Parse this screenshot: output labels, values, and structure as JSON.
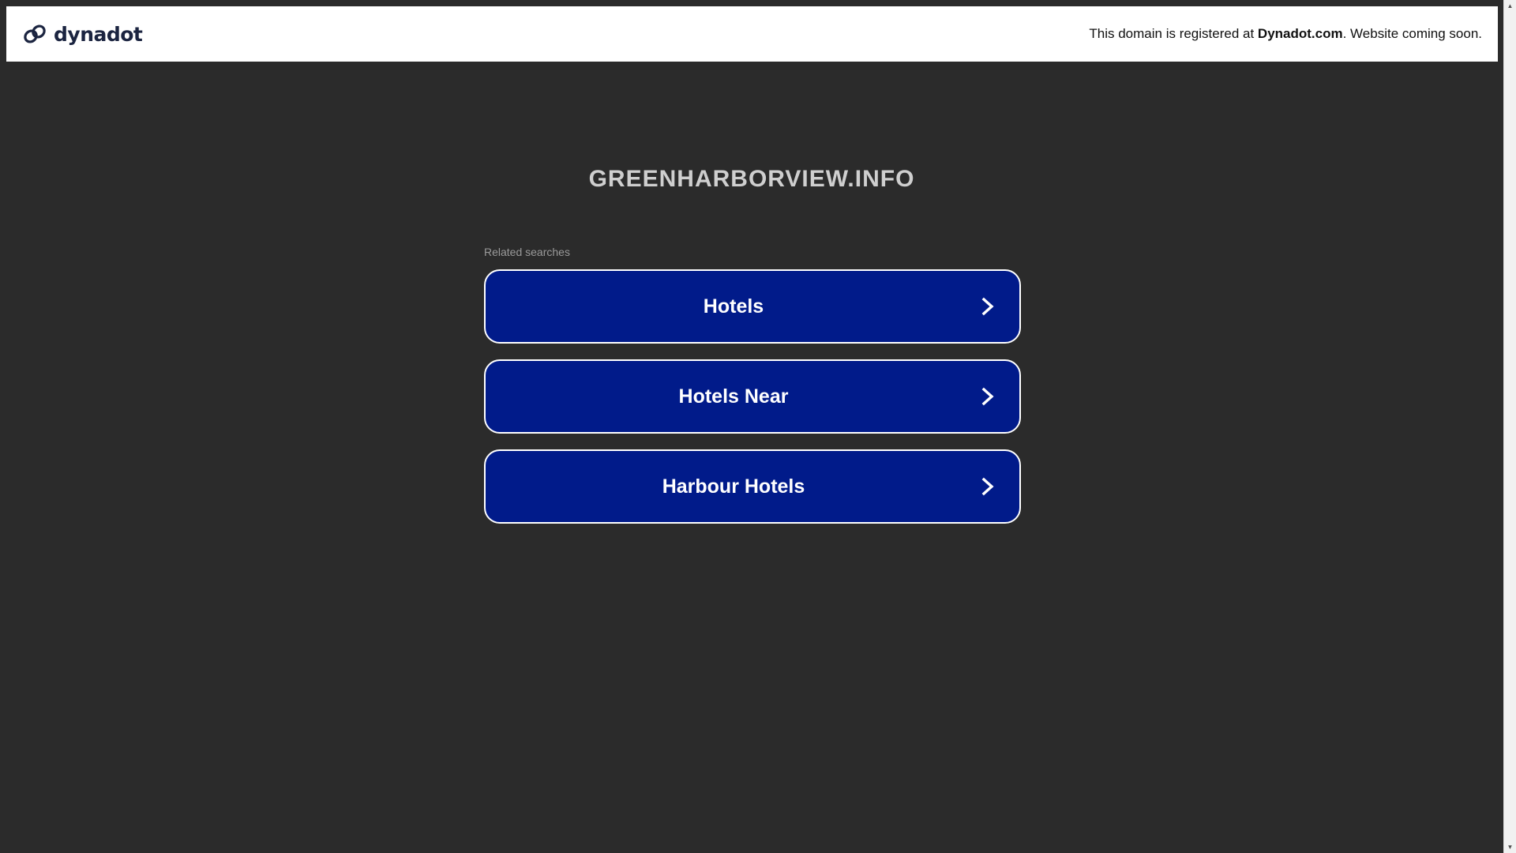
{
  "header": {
    "brand_name": "dynadot",
    "notice_prefix": "This domain is registered at ",
    "notice_brand": "Dynadot.com",
    "notice_suffix": ". Website coming soon."
  },
  "main": {
    "domain_name": "GREENHARBORVIEW.INFO",
    "related_label": "Related searches",
    "links": [
      {
        "label": "Hotels",
        "icon": "chevron-right-icon"
      },
      {
        "label": "Hotels Near",
        "icon": "chevron-right-icon"
      },
      {
        "label": "Harbour Hotels",
        "icon": "chevron-right-icon"
      }
    ]
  },
  "colors": {
    "background": "#2b2b2b",
    "header_bg": "#ffffff",
    "button_bg": "#011b8a",
    "button_border": "#ffffff",
    "brand_text": "#1b2440"
  }
}
